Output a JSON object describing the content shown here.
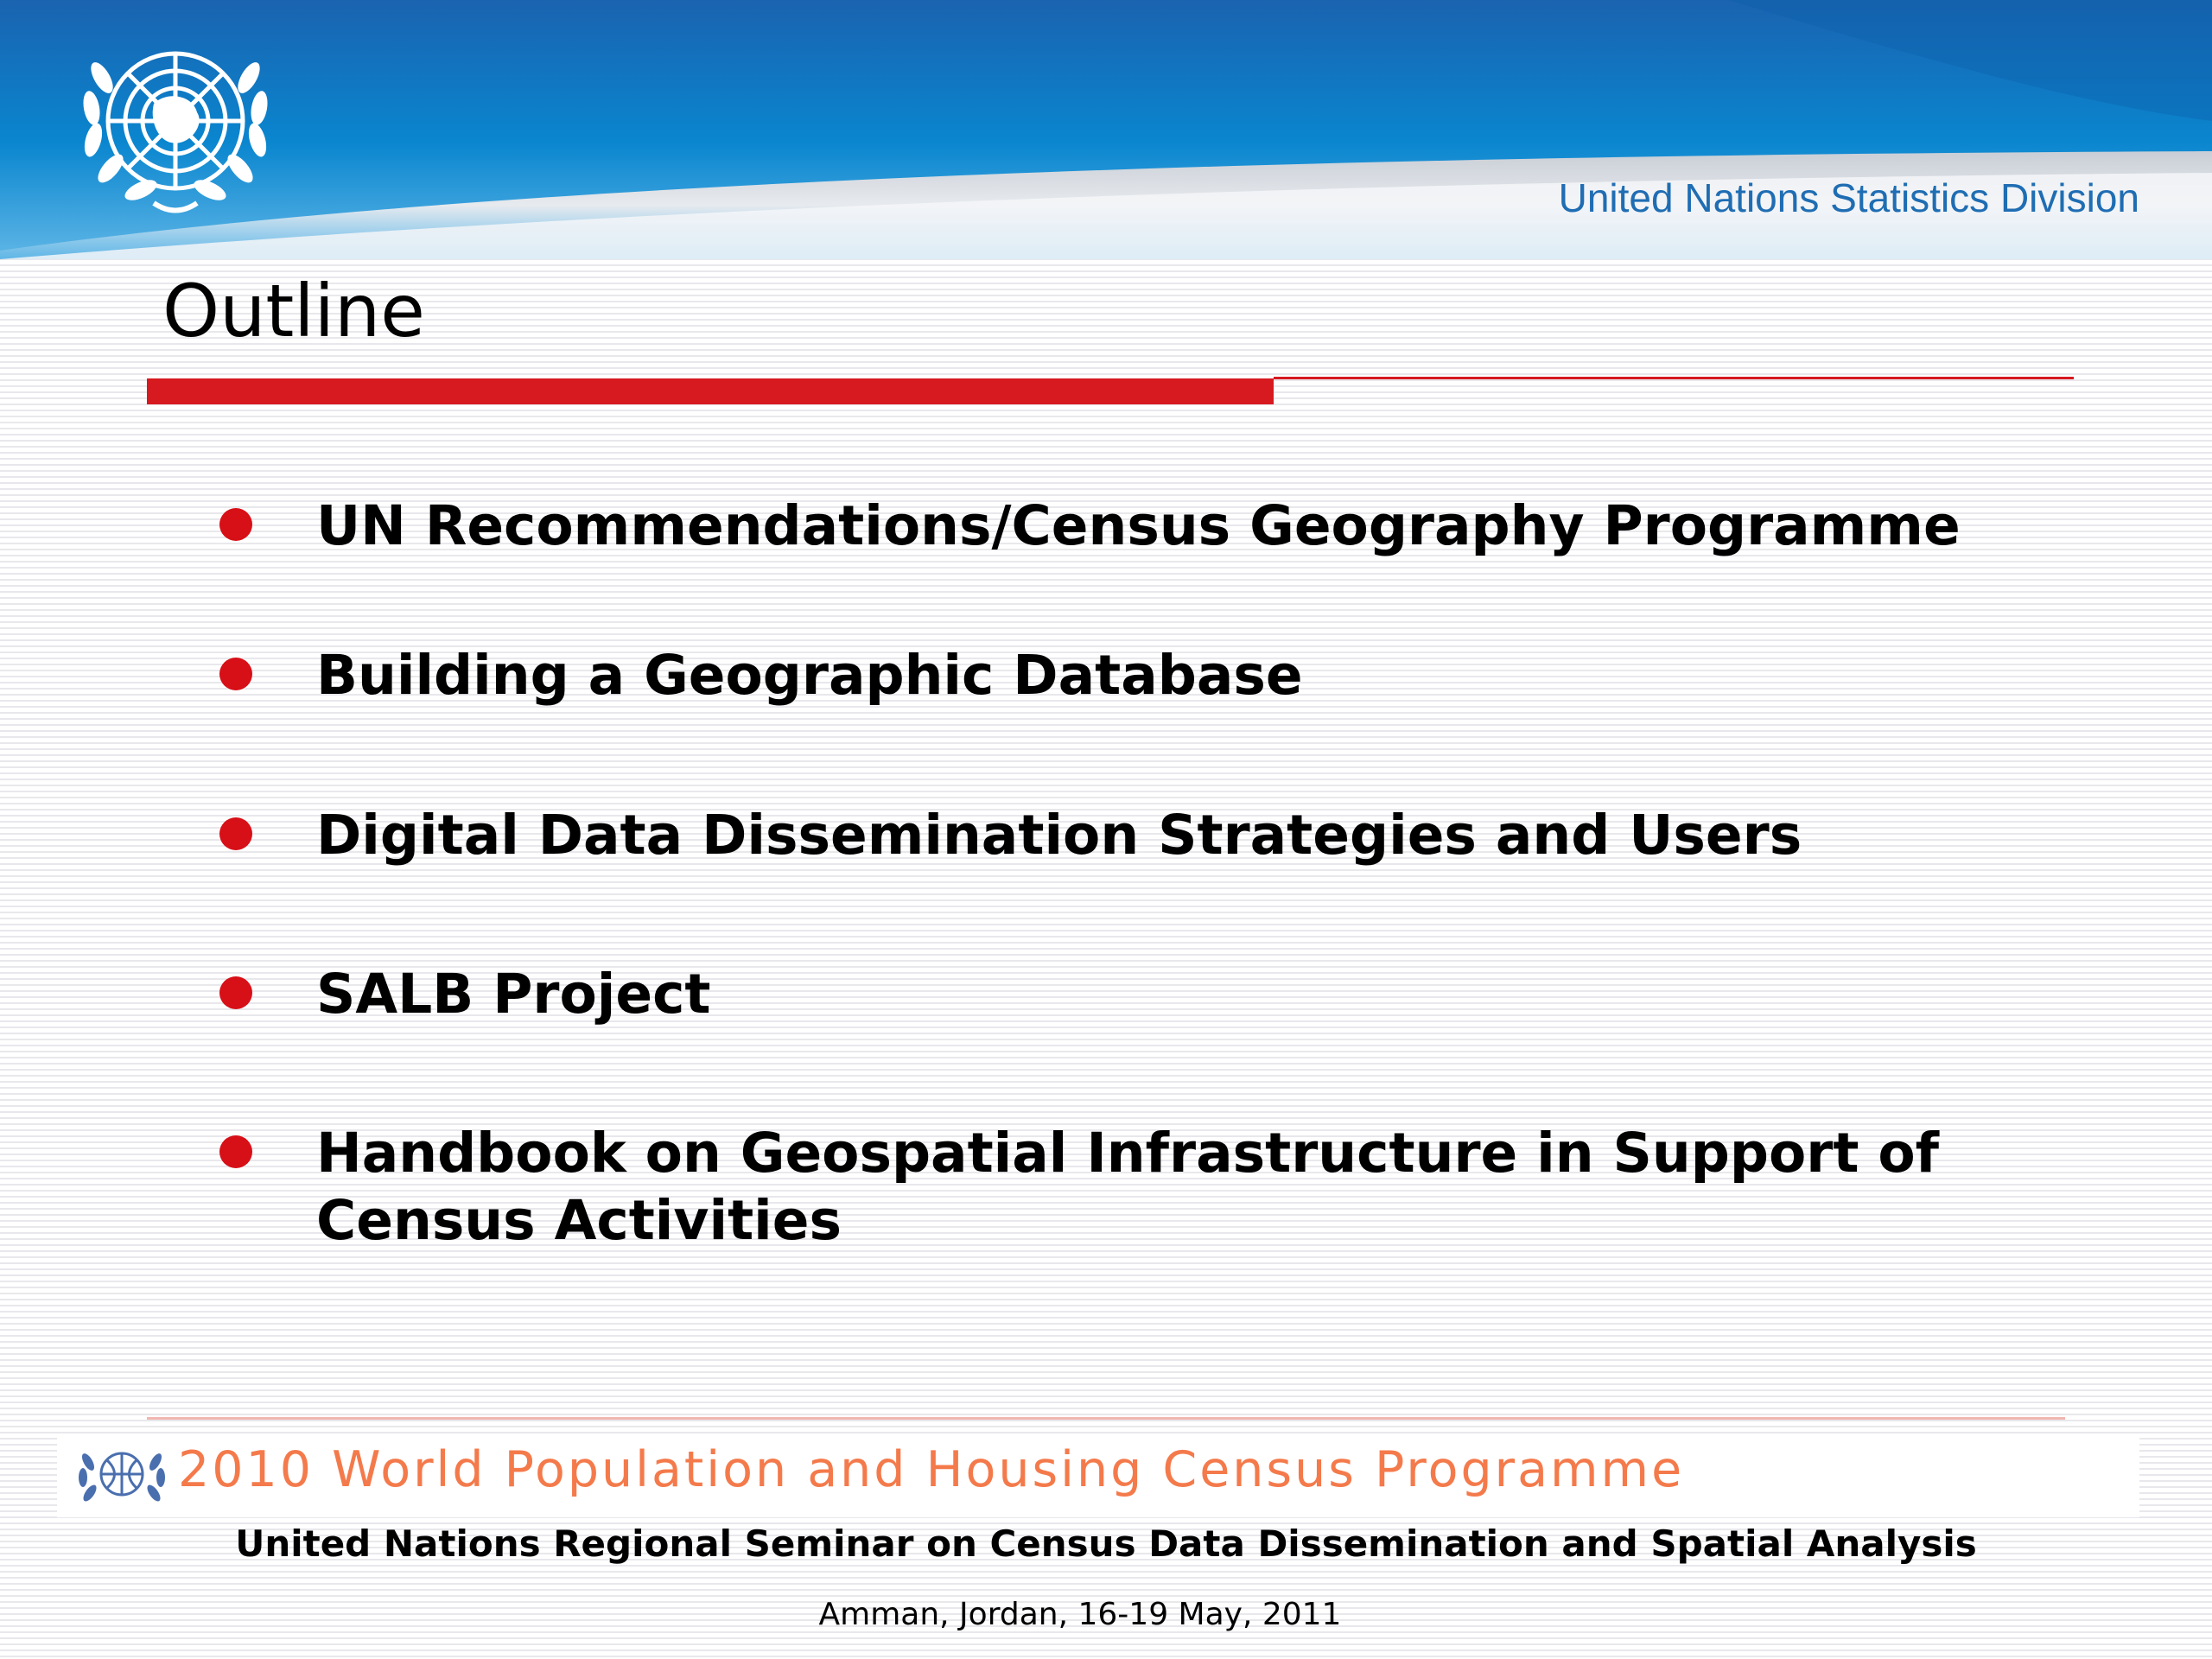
{
  "header": {
    "organization": "United Nations Statistics Division",
    "logo_icon": "un-emblem-icon",
    "colors": {
      "banner_blue": "#0b76c1",
      "banner_light": "#dfe6ef",
      "division_text": "#1f6db3"
    }
  },
  "slide": {
    "title": "Outline",
    "accent_color": "#d71920",
    "bullets": [
      {
        "text": "UN Recommendations/Census Geography Programme"
      },
      {
        "text": "Building a Geographic Database"
      },
      {
        "text": "Digital Data Dissemination Strategies and Users"
      },
      {
        "text": "SALB Project"
      },
      {
        "text": "Handbook on Geospatial Infrastructure in Support of Census Activities"
      }
    ]
  },
  "footer": {
    "programme": "2010 World Population and Housing Census Programme",
    "programme_logo_icon": "census-programme-logo-icon",
    "programme_color": "#f47a4b",
    "seminar": "United Nations Regional Seminar on Census Data Dissemination and Spatial Analysis",
    "location_date": "Amman, Jordan, 16-19 May, 2011"
  }
}
